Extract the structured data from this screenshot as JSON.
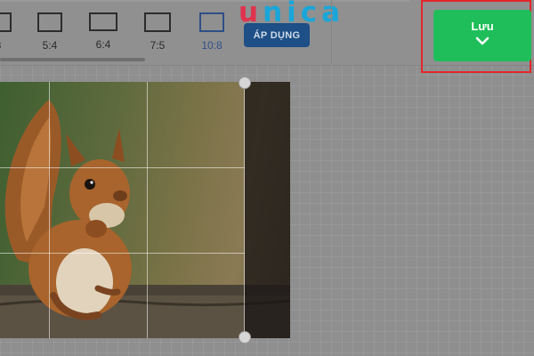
{
  "logo": {
    "first": "u",
    "rest": "nica"
  },
  "aspect_ratios": [
    {
      "label": "3",
      "active": false
    },
    {
      "label": "5:4",
      "active": false
    },
    {
      "label": "6:4",
      "active": false
    },
    {
      "label": "7:5",
      "active": false
    },
    {
      "label": "10:8",
      "active": true
    }
  ],
  "apply_button": {
    "label": "ÁP DỤNG"
  },
  "save_button": {
    "label": "Lưu",
    "icon": "chevron-down-icon"
  },
  "colors": {
    "save": "#1fbe5a",
    "apply": "#1e4f86",
    "active_ratio": "#2d4f86",
    "highlight": "#e3262b"
  },
  "image": {
    "subject": "squirrel-photo"
  }
}
